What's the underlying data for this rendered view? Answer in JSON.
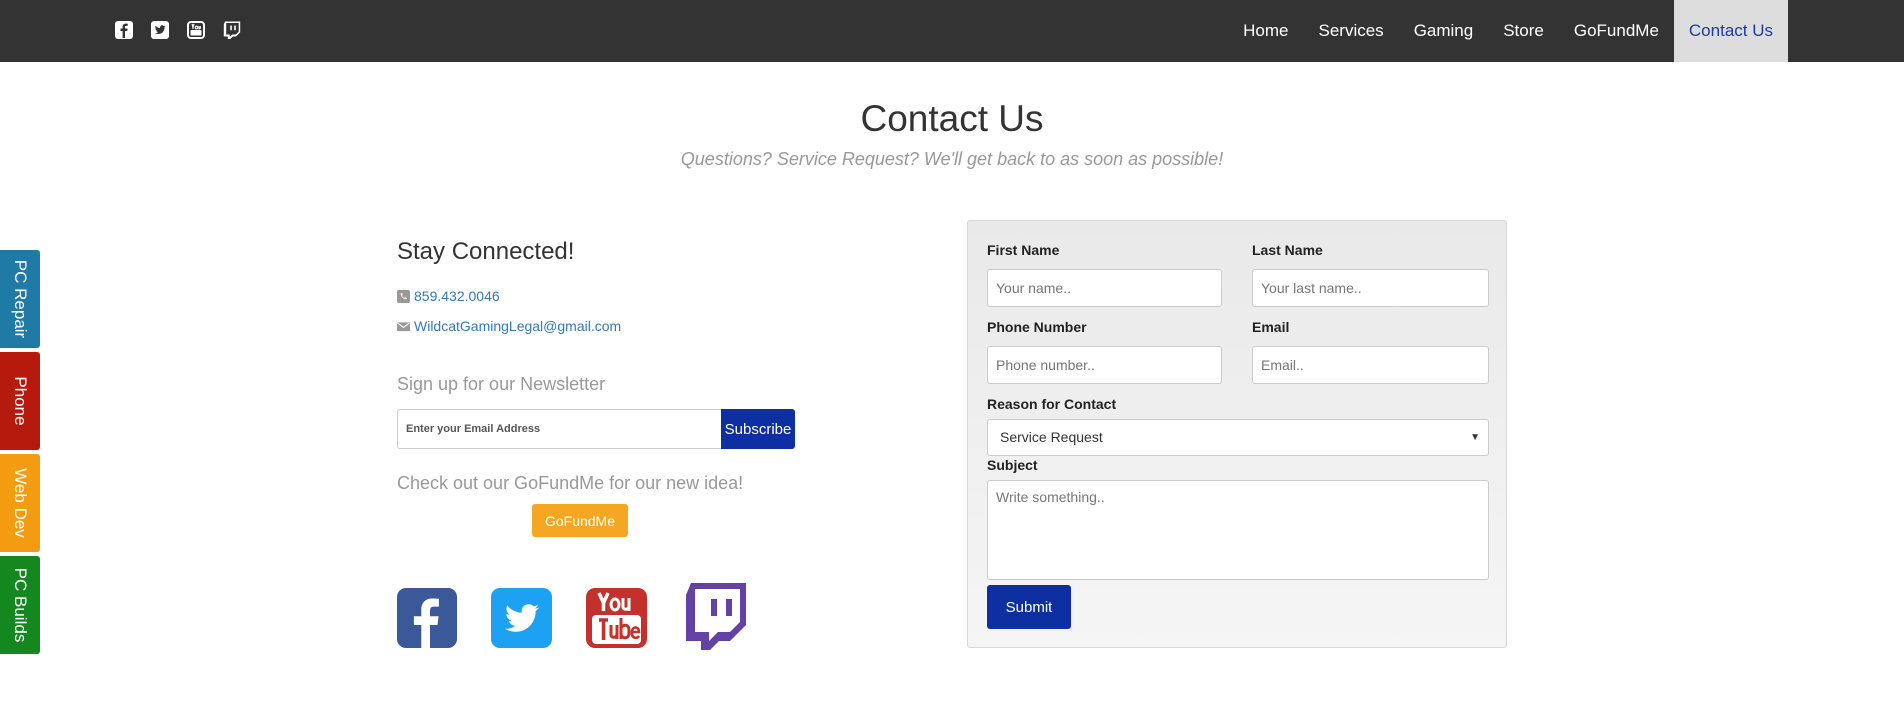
{
  "navbar": {
    "social_icons": [
      "facebook-icon",
      "twitter-icon",
      "youtube-icon",
      "twitch-icon"
    ],
    "links": [
      {
        "label": "Home"
      },
      {
        "label": "Services"
      },
      {
        "label": "Gaming"
      },
      {
        "label": "Store"
      },
      {
        "label": "GoFundMe"
      },
      {
        "label": "Contact Us",
        "active": true
      }
    ]
  },
  "header": {
    "title": "Contact Us",
    "subtitle": "Questions? Service Request? We'll get back to as soon as possible!"
  },
  "side_tabs": [
    {
      "label": "PC Repair",
      "color": "#1f7aa6"
    },
    {
      "label": "Phone",
      "color": "#b51a0c"
    },
    {
      "label": "Web Dev",
      "color": "#f39c12"
    },
    {
      "label": "PC Builds",
      "color": "#14881e"
    }
  ],
  "connect": {
    "title": "Stay Connected!",
    "phone": "859.432.0046",
    "email": "WildcatGamingLegal@gmail.com"
  },
  "newsletter": {
    "title": "Sign up for our Newsletter",
    "placeholder": "Enter your Email Address",
    "button_label": "Subscribe"
  },
  "gofundme": {
    "title": "Check out our GoFundMe for our new idea!",
    "button_label": "GoFundMe"
  },
  "social_large": {
    "facebook_color": "#3b5998",
    "twitter_color": "#1da1f2",
    "youtube_color": "#c4302b",
    "twitch_color": "#6441a5"
  },
  "form": {
    "first_name_label": "First Name",
    "first_name_placeholder": "Your name..",
    "last_name_label": "Last Name",
    "last_name_placeholder": "Your last name..",
    "phone_label": "Phone Number",
    "phone_placeholder": "Phone number..",
    "email_label": "Email",
    "email_placeholder": "Email..",
    "reason_label": "Reason for Contact",
    "reason_value": "Service Request",
    "subject_label": "Subject",
    "subject_placeholder": "Write something..",
    "submit_label": "Submit"
  }
}
